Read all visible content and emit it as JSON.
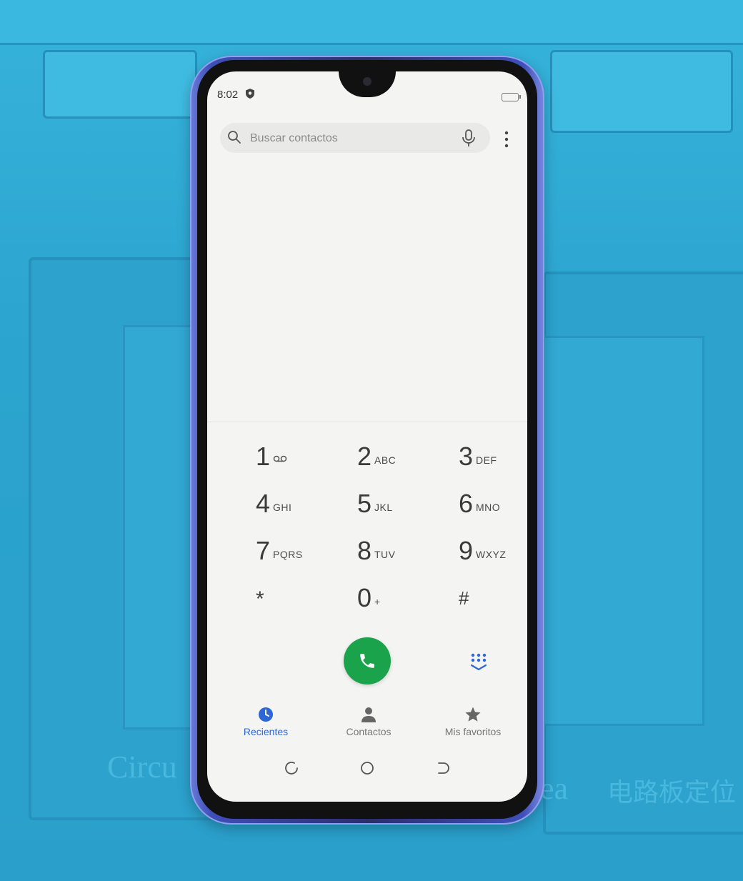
{
  "status_bar": {
    "time": "8:02"
  },
  "search": {
    "placeholder": "Buscar contactos",
    "value": ""
  },
  "dialpad": {
    "keys": [
      {
        "digit": "1",
        "letters": ""
      },
      {
        "digit": "2",
        "letters": "ABC"
      },
      {
        "digit": "3",
        "letters": "DEF"
      },
      {
        "digit": "4",
        "letters": "GHI"
      },
      {
        "digit": "5",
        "letters": "JKL"
      },
      {
        "digit": "6",
        "letters": "MNO"
      },
      {
        "digit": "7",
        "letters": "PQRS"
      },
      {
        "digit": "8",
        "letters": "TUV"
      },
      {
        "digit": "9",
        "letters": "WXYZ"
      },
      {
        "digit": "*",
        "letters": ""
      },
      {
        "digit": "0",
        "letters": "+"
      },
      {
        "digit": "#",
        "letters": ""
      }
    ]
  },
  "tabs": [
    {
      "label": "Recientes",
      "icon": "clock-icon",
      "active": true
    },
    {
      "label": "Contactos",
      "icon": "person-icon",
      "active": false
    },
    {
      "label": "Mis favoritos",
      "icon": "star-icon",
      "active": false
    }
  ],
  "colors": {
    "call_button": "#1aa34a",
    "active_tab": "#2d67d6",
    "mat": "#2aa6d0"
  },
  "mat_print": {
    "left": "Circu",
    "right_latin": "ea",
    "right_cjk": "电路板定位"
  }
}
